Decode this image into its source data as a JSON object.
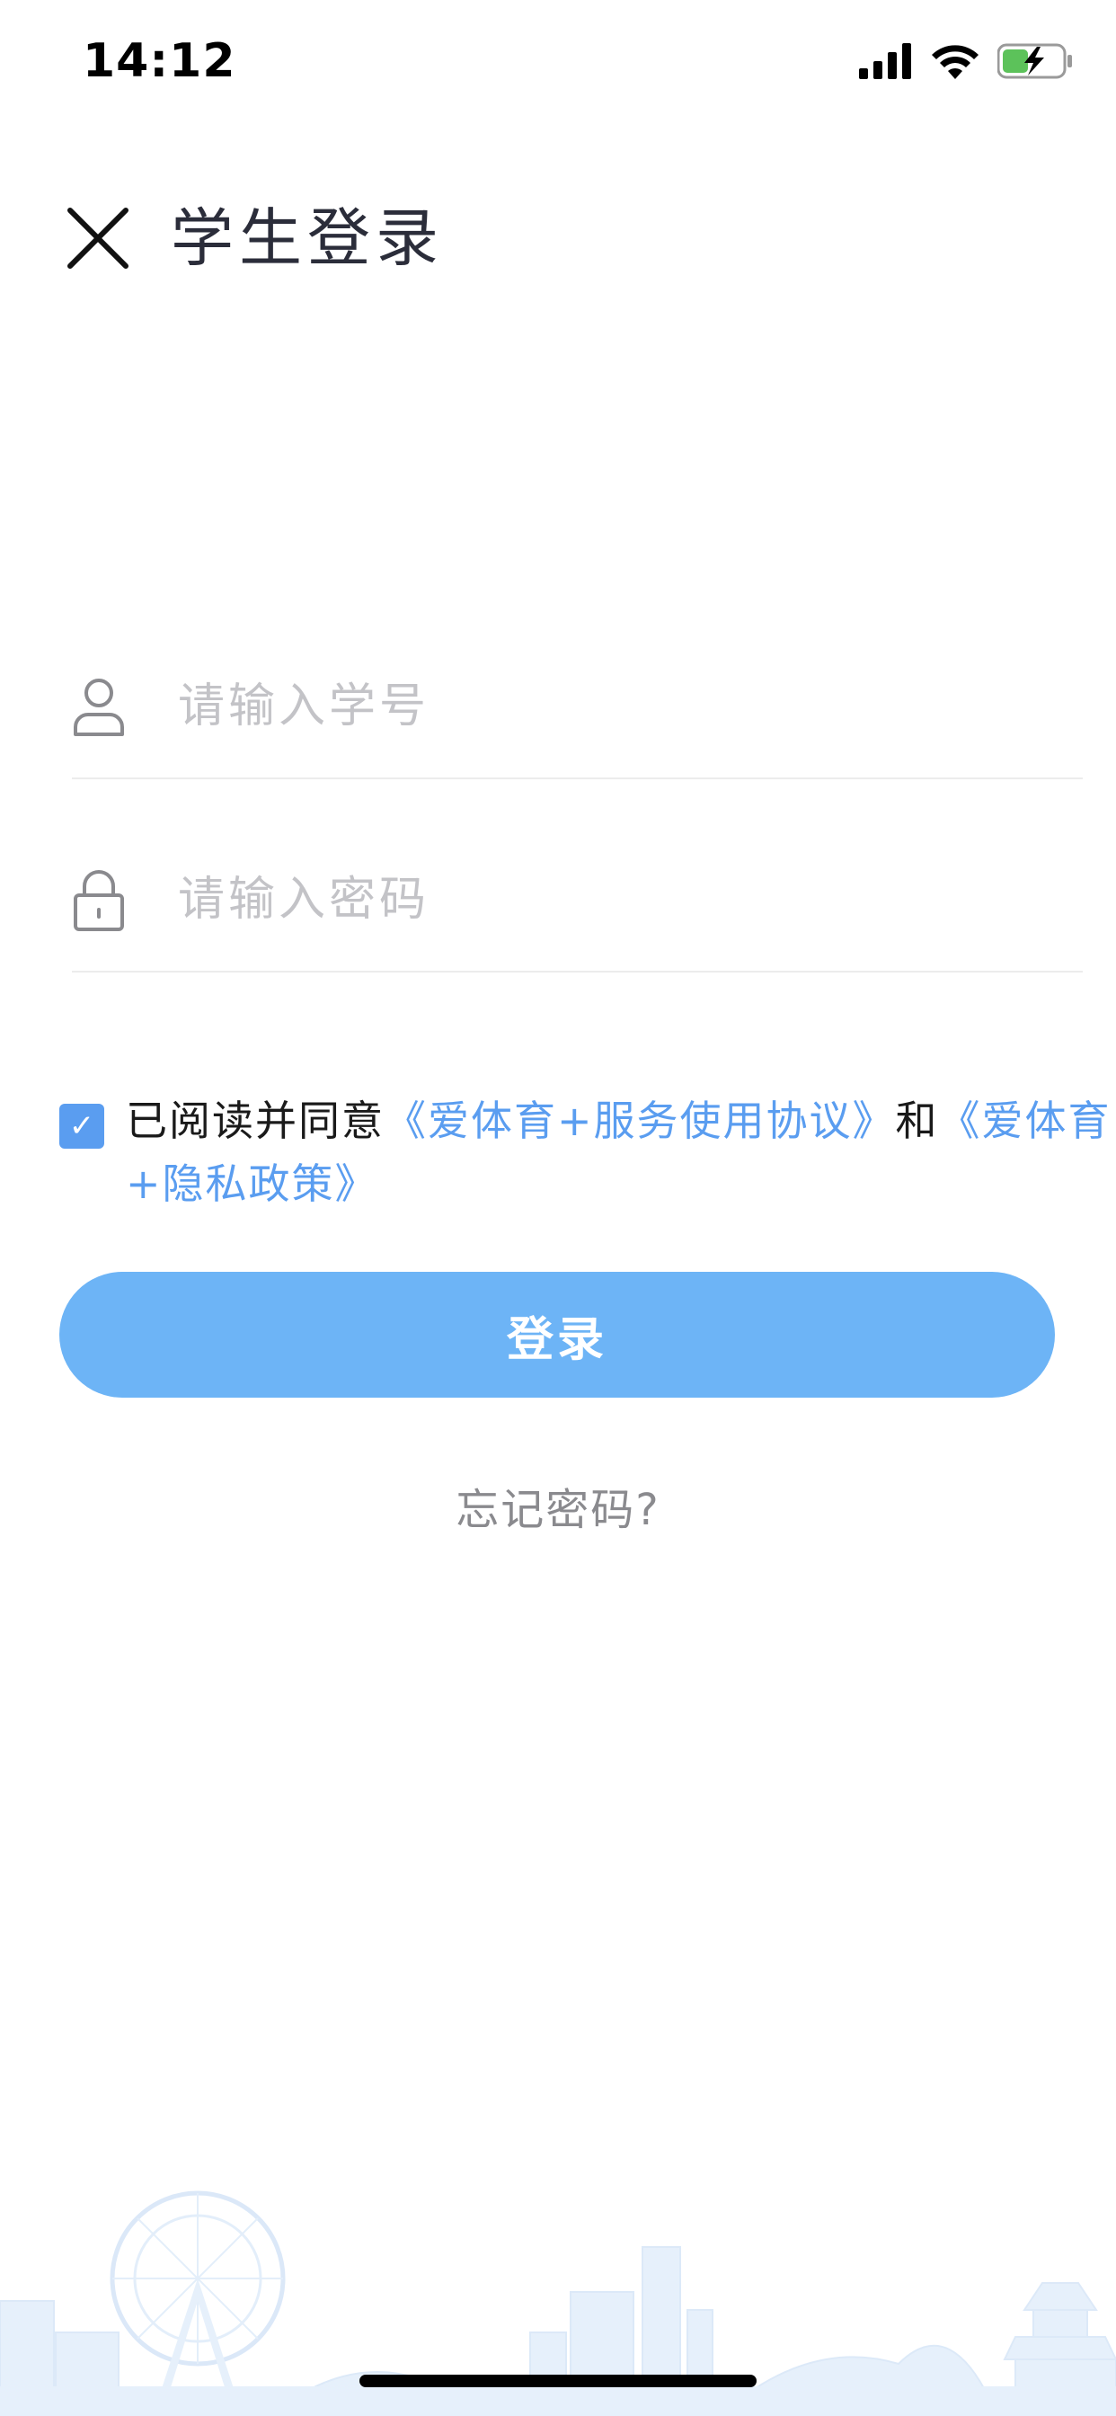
{
  "status_bar": {
    "time": "14:12",
    "icons": [
      "signal-icon",
      "wifi-icon",
      "battery-charging-icon"
    ],
    "battery_color": "#5cc25a"
  },
  "header": {
    "title": "学生登录",
    "close_icon": "close-icon"
  },
  "form": {
    "username": {
      "icon": "user-icon",
      "placeholder": "请输入学号",
      "value": ""
    },
    "password": {
      "icon": "lock-icon",
      "placeholder": "请输入密码",
      "value": ""
    }
  },
  "agreement": {
    "checked": true,
    "prefix": "已阅读并同意",
    "service_link": "《爱体育+服务使用协议》",
    "conjunction": "和",
    "privacy_link": "《爱体育+隐私政策》"
  },
  "login_button": {
    "label": "登录"
  },
  "forgot_password": {
    "label": "忘记密码?"
  },
  "colors": {
    "accent": "#5a9df0",
    "button": "#6db4f6",
    "title": "#2b2d3a",
    "placeholder": "#c3c3c7",
    "muted": "#8a8a8e",
    "skyline": "#e6f0fb"
  }
}
